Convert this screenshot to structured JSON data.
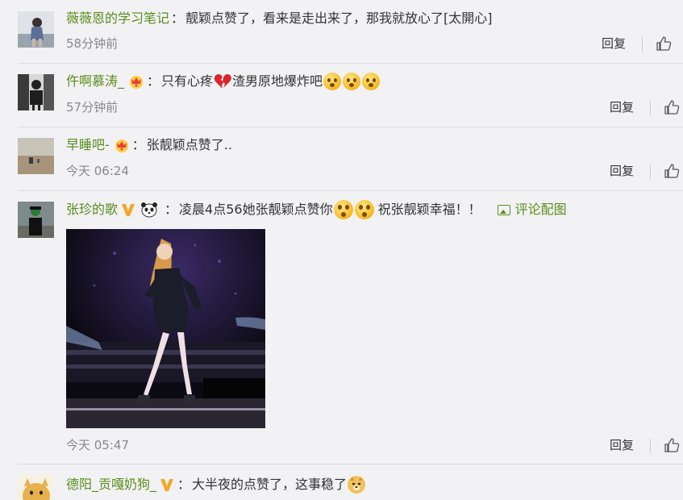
{
  "actions": {
    "reply_label": "回复"
  },
  "comments": [
    {
      "user": "薇薇恩的学习笔记",
      "sep": "：",
      "text": "靓颖点赞了，看来是走出来了，那我就放心了[太開心]",
      "time": "58分钟前"
    },
    {
      "user": "仵啊慕涛_",
      "sep": "：",
      "text_before": "只有心疼",
      "text_after": "渣男原地爆炸吧",
      "time": "57分钟前"
    },
    {
      "user": "早睡吧-",
      "sep": "：",
      "text": "张靓颖点赞了..",
      "time": "今天 06:24"
    },
    {
      "user": "张珍的歌",
      "sep": "：",
      "text_before": "凌晨4点56她张靓颖点赞你",
      "text_after": "祝张靓颖幸福！！",
      "photo_link": "评论配图",
      "time": "今天 05:47"
    },
    {
      "user": "德阳_贡嘎奶狗_",
      "sep": "：",
      "text": "大半夜的点赞了，这事稳了"
    }
  ],
  "colors": {
    "username": "#5b8c1a",
    "background": "#f2f2f5"
  }
}
